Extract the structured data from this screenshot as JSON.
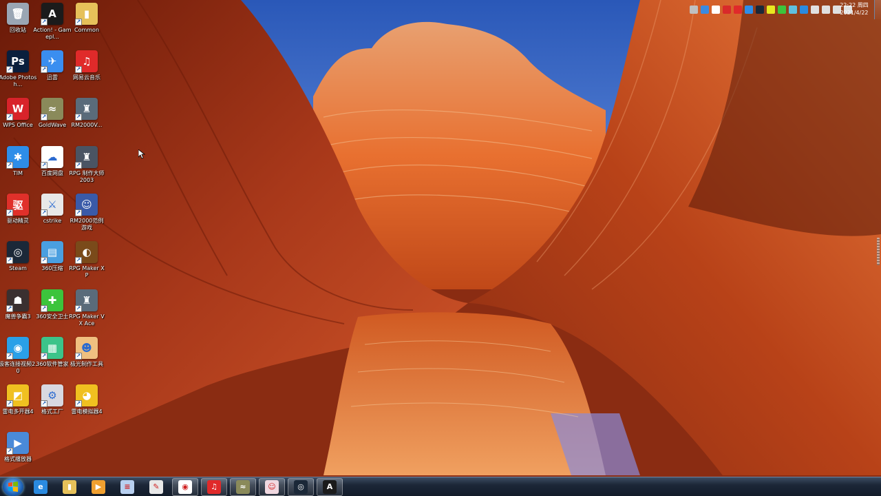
{
  "desktop": {
    "icons": [
      {
        "id": "recycle-bin",
        "label": "回收站",
        "color": "#9aa6b4",
        "glyph": "🗑",
        "icon": "recycle-bin-icon"
      },
      {
        "id": "action-gameplay",
        "label": "Action! - Gamepl...",
        "color": "#1b1b1b",
        "glyph": "A",
        "icon": "action-icon"
      },
      {
        "id": "common",
        "label": "Common",
        "color": "#e6c15a",
        "glyph": "▮",
        "icon": "folder-icon"
      },
      {
        "id": "photoshop",
        "label": "Adobe Photosh...",
        "color": "#0a1f3d",
        "glyph": "Ps",
        "icon": "photoshop-icon"
      },
      {
        "id": "xunlei",
        "label": "迅雷",
        "color": "#3a8ef0",
        "glyph": "✈",
        "icon": "xunlei-icon"
      },
      {
        "id": "netease-music",
        "label": "网易云音乐",
        "color": "#e02a2a",
        "glyph": "♫",
        "icon": "music-icon"
      },
      {
        "id": "wps",
        "label": "WPS Office",
        "color": "#d8232a",
        "glyph": "W",
        "icon": "wps-icon"
      },
      {
        "id": "goldwave",
        "label": "GoldWave",
        "color": "#8a8a5a",
        "glyph": "≈",
        "icon": "goldwave-icon"
      },
      {
        "id": "rm2000",
        "label": "RM2000V...",
        "color": "#5a6b7a",
        "glyph": "♜",
        "icon": "rm2000-icon"
      },
      {
        "id": "tim",
        "label": "TIM",
        "color": "#2e8de8",
        "glyph": "✱",
        "icon": "tim-icon"
      },
      {
        "id": "baidu-pan",
        "label": "百度网盘",
        "color": "#ffffff",
        "glyph": "☁",
        "icon": "cloud-icon"
      },
      {
        "id": "rpg-maker-2003",
        "label": "RPG 制作大师 2003",
        "color": "#4a5463",
        "glyph": "♜",
        "icon": "rpg-maker-2003-icon"
      },
      {
        "id": "driver",
        "label": "驱动精灵",
        "color": "#e0302a",
        "glyph": "驱",
        "icon": "driver-icon"
      },
      {
        "id": "cstrike",
        "label": "cstrike",
        "color": "#e8e8e8",
        "glyph": "⚔",
        "icon": "cstrike-icon"
      },
      {
        "id": "rm2000-game",
        "label": "RM2000范例游戏",
        "color": "#3a5aa8",
        "glyph": "☺",
        "icon": "game-icon"
      },
      {
        "id": "steam",
        "label": "Steam",
        "color": "#1b2838",
        "glyph": "◎",
        "icon": "steam-icon"
      },
      {
        "id": "360zip",
        "label": "360压缩",
        "color": "#4a9fe0",
        "glyph": "▤",
        "icon": "zip-icon"
      },
      {
        "id": "rpg-maker-xp",
        "label": "RPG Maker XP",
        "color": "#7a4a1a",
        "glyph": "◐",
        "icon": "rpg-maker-xp-icon"
      },
      {
        "id": "warcraft3",
        "label": "魔兽争霸3",
        "color": "#3a3030",
        "glyph": "☗",
        "icon": "warcraft-icon"
      },
      {
        "id": "360safe",
        "label": "360安全卫士",
        "color": "#3cc43c",
        "glyph": "✚",
        "icon": "shield-plus-icon"
      },
      {
        "id": "rpg-maker-vxace",
        "label": "RPG Maker VX Ace",
        "color": "#5a6b7a",
        "glyph": "♜",
        "icon": "rpg-maker-vxace-icon"
      },
      {
        "id": "jike-video",
        "label": "极客连接视频2.0",
        "color": "#2aa0e8",
        "glyph": "◉",
        "icon": "video-icon"
      },
      {
        "id": "360-software",
        "label": "360软件管家",
        "color": "#3cc48a",
        "glyph": "▦",
        "icon": "software-manager-icon"
      },
      {
        "id": "jiguang-tool",
        "label": "极光制作工具",
        "color": "#f0c080",
        "glyph": "☻",
        "icon": "tool-icon"
      },
      {
        "id": "leidian-multi",
        "label": "雷电多开器4",
        "color": "#f0c020",
        "glyph": "◩",
        "icon": "multi-instance-icon"
      },
      {
        "id": "geshi-factory",
        "label": "格式工厂",
        "color": "#d8d8e0",
        "glyph": "⚙",
        "icon": "factory-icon"
      },
      {
        "id": "leidian-emulator",
        "label": "雷电模拟器4",
        "color": "#f0c020",
        "glyph": "◕",
        "icon": "emulator-icon"
      },
      {
        "id": "geshi-player",
        "label": "格式播放器",
        "color": "#4a8ad8",
        "glyph": "▶",
        "icon": "player-icon"
      }
    ]
  },
  "taskbar": {
    "start_label": "Start",
    "buttons": [
      {
        "id": "ie",
        "color": "#2a8ae0",
        "glyph": "e",
        "open": false,
        "icon": "ie-icon"
      },
      {
        "id": "explorer",
        "color": "#e6c15a",
        "glyph": "▮",
        "open": false,
        "icon": "explorer-icon"
      },
      {
        "id": "media-player",
        "color": "#f0a030",
        "glyph": "▶",
        "open": false,
        "icon": "media-player-icon"
      },
      {
        "id": "notepad",
        "color": "#b8d0f0",
        "glyph": "≡",
        "open": false,
        "icon": "notepad-icon"
      },
      {
        "id": "paint",
        "color": "#e8e8e8",
        "glyph": "✎",
        "open": false,
        "icon": "paint-icon"
      },
      {
        "id": "chrome",
        "color": "#ffffff",
        "glyph": "◉",
        "open": true,
        "icon": "chrome-icon"
      },
      {
        "id": "netease-music",
        "color": "#e02a2a",
        "glyph": "♫",
        "open": true,
        "icon": "music-icon"
      },
      {
        "id": "goldwave",
        "color": "#8a8a5a",
        "glyph": "≈",
        "open": true,
        "icon": "goldwave-icon"
      },
      {
        "id": "anime-app",
        "color": "#f0d8e0",
        "glyph": "☺",
        "open": true,
        "icon": "anime-icon"
      },
      {
        "id": "steam",
        "color": "#1b2838",
        "glyph": "◎",
        "open": true,
        "icon": "steam-icon"
      },
      {
        "id": "action",
        "color": "#1b1b1b",
        "glyph": "A",
        "open": true,
        "icon": "action-icon"
      }
    ],
    "tray_icons": [
      {
        "color": "#c0c0c0",
        "icon": "keyboard-icon"
      },
      {
        "color": "#3a8ae0",
        "icon": "help-icon"
      },
      {
        "color": "#ffffff",
        "icon": "cloud-icon"
      },
      {
        "color": "#d82a2a",
        "icon": "action-icon"
      },
      {
        "color": "#e02a2a",
        "icon": "music-icon"
      },
      {
        "color": "#2e8de8",
        "icon": "tim-icon"
      },
      {
        "color": "#1b2838",
        "icon": "steam-icon"
      },
      {
        "color": "#e8e820",
        "icon": "360-icon"
      },
      {
        "color": "#3cc43c",
        "icon": "security-icon"
      },
      {
        "color": "#60c0e0",
        "icon": "update-icon"
      },
      {
        "color": "#2a8ae0",
        "icon": "sync-icon"
      },
      {
        "color": "#e0e0e0",
        "icon": "flag-icon"
      },
      {
        "color": "#e0e0e0",
        "icon": "display-icon"
      },
      {
        "color": "#e0e0e0",
        "icon": "network-icon"
      },
      {
        "color": "#e0e0e0",
        "icon": "volume-icon"
      }
    ],
    "clock": {
      "time": "22:22 周四",
      "date": "2021/4/22"
    }
  }
}
